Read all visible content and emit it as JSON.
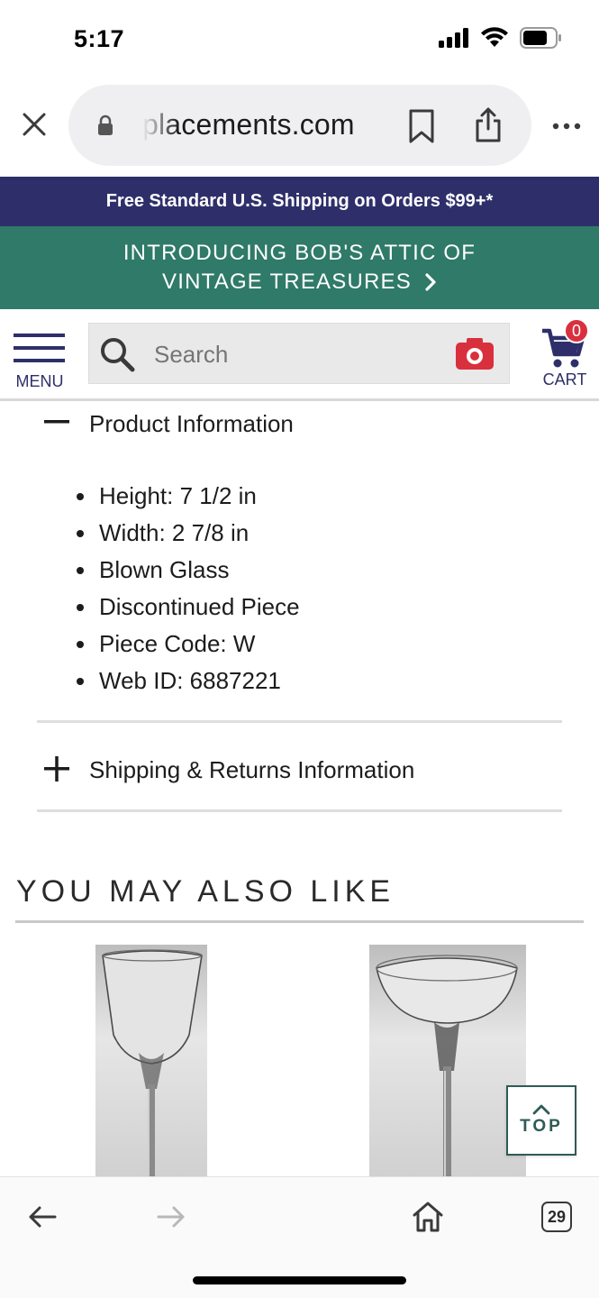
{
  "status_bar": {
    "time": "5:17",
    "icons": [
      "signal-icon",
      "wifi-icon",
      "battery-icon"
    ]
  },
  "browser": {
    "url": "placements.com",
    "icons": [
      "close-icon",
      "lock-icon",
      "bookmark-icon",
      "share-icon",
      "more-icon"
    ]
  },
  "banners": {
    "shipping": "Free Standard U.S. Shipping on Orders $99+*",
    "attic_line1": "INTRODUCING BOB'S ATTIC OF",
    "attic_line2": "VINTAGE TREASURES"
  },
  "header": {
    "menu_label": "MENU",
    "search_placeholder": "Search",
    "cart_label": "CART",
    "cart_count": "0",
    "colors": {
      "navy": "#2e2f6a",
      "red": "#d9303e",
      "green": "#2f7a68"
    }
  },
  "product_info": {
    "title": "Product Information",
    "expanded": true,
    "items": [
      "Height: 7 1/2 in",
      "Width: 2 7/8 in",
      "Blown Glass",
      "Discontinued Piece",
      "Piece Code: W",
      "Web ID: 6887221"
    ]
  },
  "shipping_info": {
    "title": "Shipping & Returns Information",
    "expanded": false
  },
  "also_like": {
    "heading": "YOU MAY ALSO LIKE",
    "products": [
      {
        "image": "wine-glass-image"
      },
      {
        "image": "champagne-coupe-image"
      }
    ]
  },
  "top_button": {
    "label": "TOP"
  },
  "toolbar": {
    "tabs_count": "29",
    "icons": [
      "back-arrow-icon",
      "forward-arrow-icon",
      "home-icon",
      "tabs-icon"
    ]
  }
}
